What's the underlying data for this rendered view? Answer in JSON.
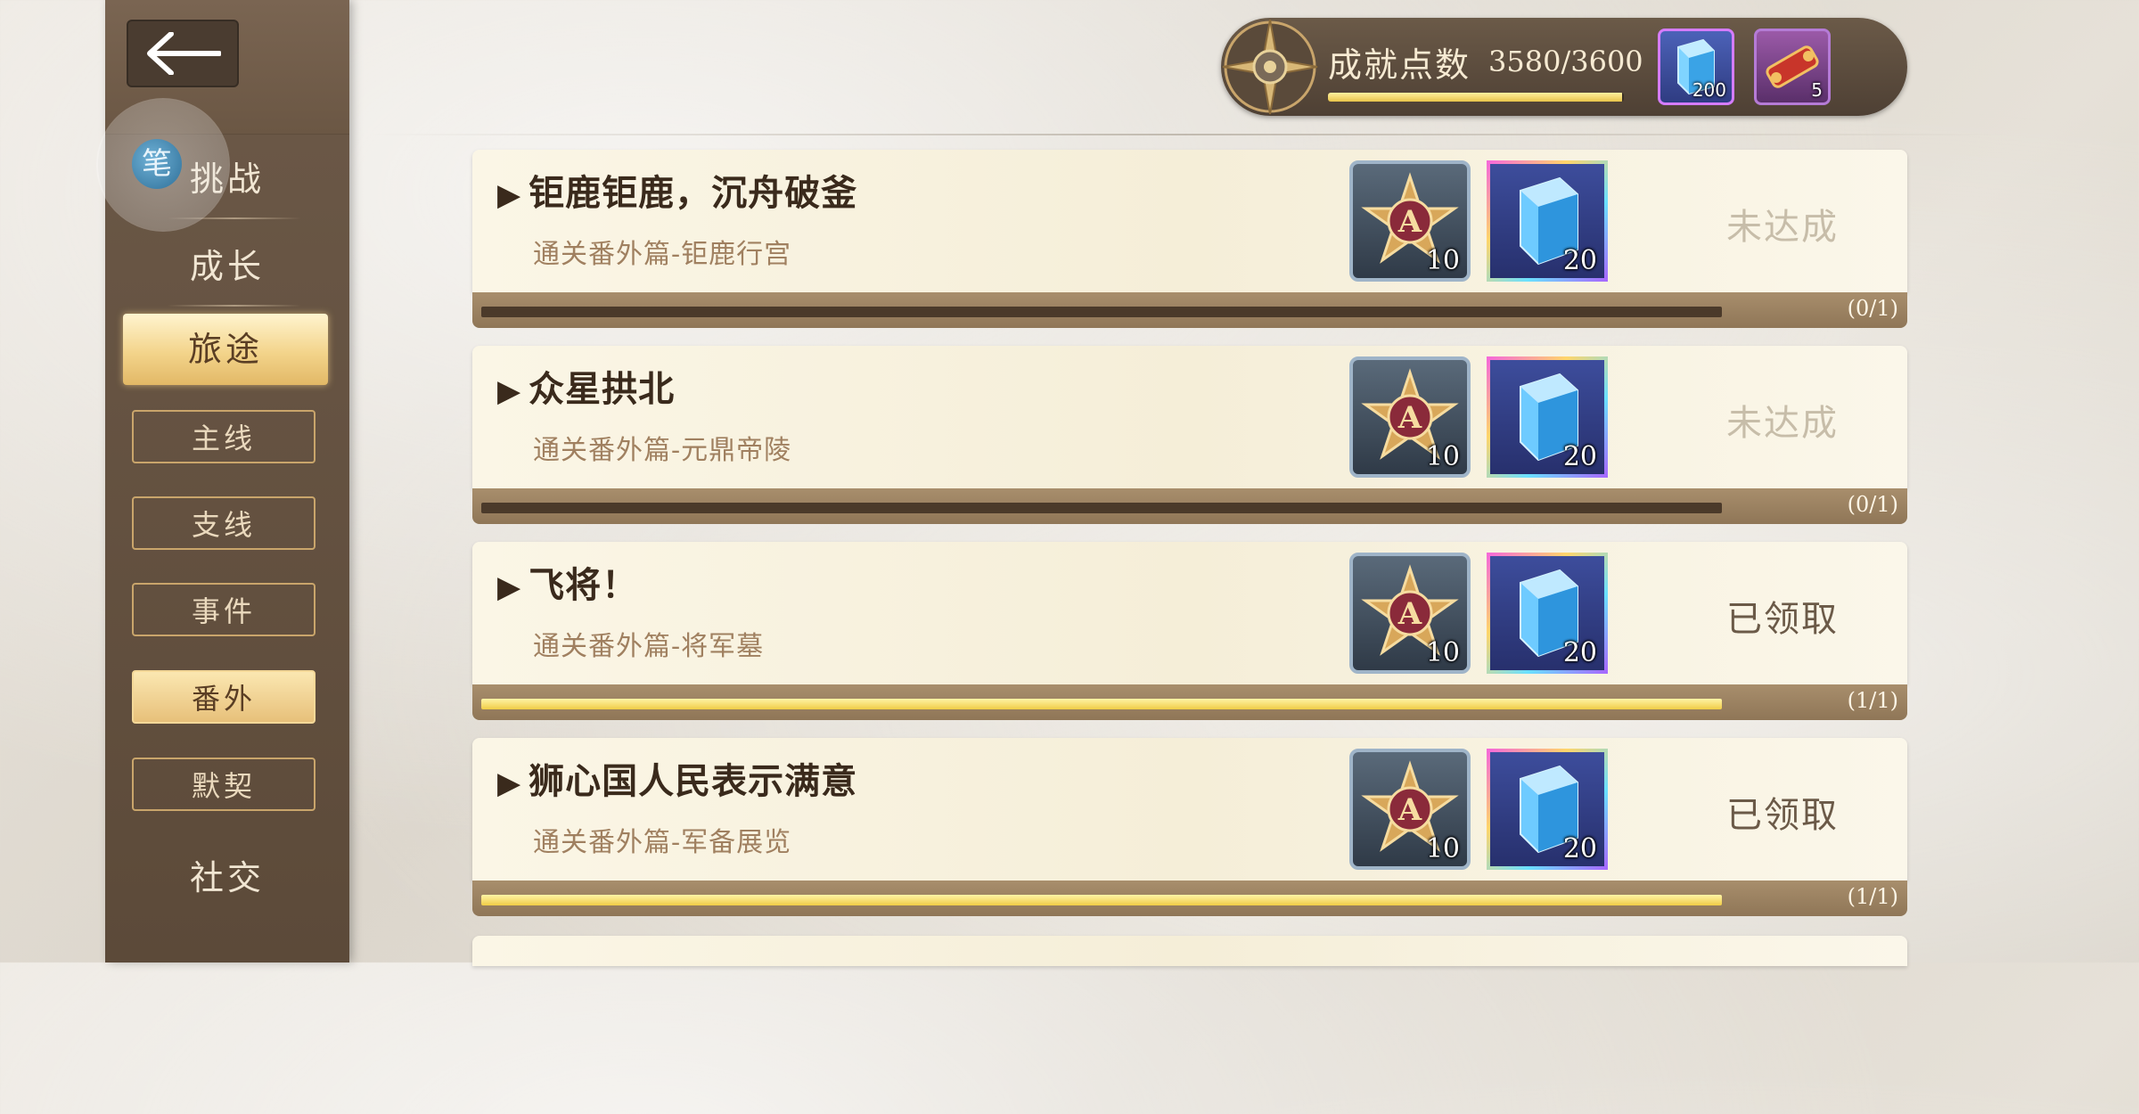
{
  "sidebar": {
    "avatar_glyph": "笔",
    "categories": {
      "challenge": "挑战",
      "growth": "成长",
      "journey": "旅途",
      "social": "社交"
    },
    "subcategories": [
      "主线",
      "支线",
      "事件",
      "番外",
      "默契"
    ],
    "active_category": "旅途",
    "active_subcategory": "番外"
  },
  "header": {
    "points_label": "成就点数",
    "points_value": "3580/3600",
    "points_progress": 0.994,
    "items": [
      {
        "icon": "blue-crystal-icon",
        "count": "200"
      },
      {
        "icon": "red-scroll-icon",
        "count": "5"
      }
    ]
  },
  "achievements": [
    {
      "title": "钜鹿钜鹿，沉舟破釜",
      "subtitle": "通关番外篇-钜鹿行宫",
      "rewards": [
        {
          "icon": "star-a-badge-icon",
          "count": "10"
        },
        {
          "icon": "blue-crystal-icon",
          "count": "20"
        }
      ],
      "status": "未达成",
      "progress_text": "(0/1)",
      "progress": 0
    },
    {
      "title": "众星拱北",
      "subtitle": "通关番外篇-元鼎帝陵",
      "rewards": [
        {
          "icon": "star-a-badge-icon",
          "count": "10"
        },
        {
          "icon": "blue-crystal-icon",
          "count": "20"
        }
      ],
      "status": "未达成",
      "progress_text": "(0/1)",
      "progress": 0
    },
    {
      "title": "飞将！",
      "subtitle": "通关番外篇-将军墓",
      "rewards": [
        {
          "icon": "star-a-badge-icon",
          "count": "10"
        },
        {
          "icon": "blue-crystal-icon",
          "count": "20"
        }
      ],
      "status": "已领取",
      "progress_text": "(1/1)",
      "progress": 1
    },
    {
      "title": "狮心国人民表示满意",
      "subtitle": "通关番外篇-军备展览",
      "rewards": [
        {
          "icon": "star-a-badge-icon",
          "count": "10"
        },
        {
          "icon": "blue-crystal-icon",
          "count": "20"
        }
      ],
      "status": "已领取",
      "progress_text": "(1/1)",
      "progress": 1
    }
  ],
  "colors": {
    "progress_fill": "#f0cc46",
    "status_pending": "#c7bda9",
    "status_done": "#6b5a48"
  }
}
